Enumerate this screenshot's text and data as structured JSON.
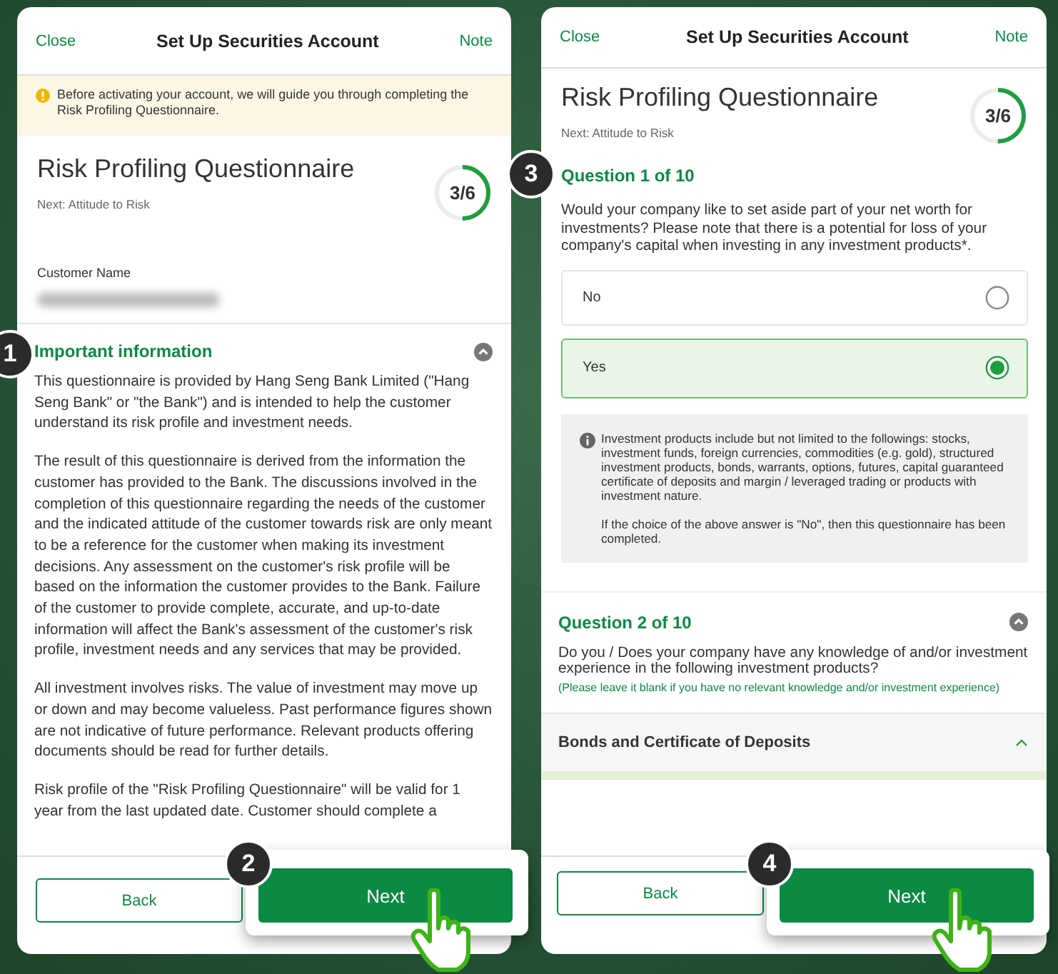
{
  "left_screen": {
    "header": {
      "close": "Close",
      "title": "Set Up Securities Account",
      "note": "Note"
    },
    "notice": "Before activating your account, we will guide you through completing the Risk Profiling Questionnaire.",
    "questionnaire": {
      "title": "Risk Profiling Questionnaire",
      "subtitle": "Next: Attitude to Risk",
      "progress": "3/6",
      "level": 0.5
    },
    "customer_name_label": "Customer Name",
    "important_info": {
      "title": "Important information",
      "expanded": true,
      "step": "1",
      "paragraphs": [
        "This questionnaire is provided by Hang Seng Bank Limited (\"Hang Seng Bank\" or \"the Bank\") and is intended to help the customer understand its risk profile and investment needs.",
        "The result of this questionnaire is derived from the information the customer has provided to the Bank. The discussions involved in the completion of this questionnaire regarding the needs of the customer and the indicated attitude of the customer towards risk are only meant to be a reference for the customer when making its investment decisions. Any assessment on the customer's risk profile will be based on the information the customer provides to the Bank. Failure of the customer to provide complete, accurate, and up-to-date information will affect the Bank's assessment of the customer's risk profile, investment needs and any services that may be provided.",
        "All investment involves risks. The value of investment may move up or down and may become valueless. Past performance figures shown are not indicative of future performance. Relevant products offering documents should be read for further details.",
        "Risk profile of the \"Risk Profiling Questionnaire\" will be valid for 1 year from the last updated date. Customer should complete a"
      ]
    },
    "footer": {
      "back": "Back",
      "next": "Next",
      "step": "2"
    }
  },
  "right_screen": {
    "header": {
      "close": "Close",
      "title": "Set Up Securities Account",
      "note": "Note"
    },
    "questionnaire": {
      "title": "Risk Profiling Questionnaire",
      "subtitle": "Next: Attitude to Risk",
      "progress": "3/6",
      "level": 0.5
    },
    "question_1": {
      "step": "3",
      "title": "Question 1 of 10",
      "text": "Would your company like to set aside part of your net worth for investments? Please note that there is a potential for loss of your company's capital when investing in any investment products*.",
      "options": [
        {
          "label": "No",
          "selected": false
        },
        {
          "label": "Yes",
          "selected": true
        }
      ],
      "note_paragraphs": [
        "Investment products include but not limited to the followings: stocks, investment funds, foreign currencies, commodities (e.g. gold), structured investment products, bonds, warrants, options, futures, capital guaranteed certificate of deposits and margin / leveraged trading or products with investment nature.",
        "If the choice of the above answer is \"No\", then this questionnaire has been completed."
      ]
    },
    "question_2": {
      "title": "Question 2 of 10",
      "expanded": true,
      "text": "Do you / Does your company have any knowledge of and/or investment experience in the following investment products?",
      "hint": "(Please leave it blank if you have no relevant knowledge and/or investment experience)"
    },
    "category": {
      "title": "Bonds and Certificate of Deposits",
      "expanded": true
    },
    "footer": {
      "back": "Back",
      "next": "Next",
      "step": "4"
    }
  }
}
